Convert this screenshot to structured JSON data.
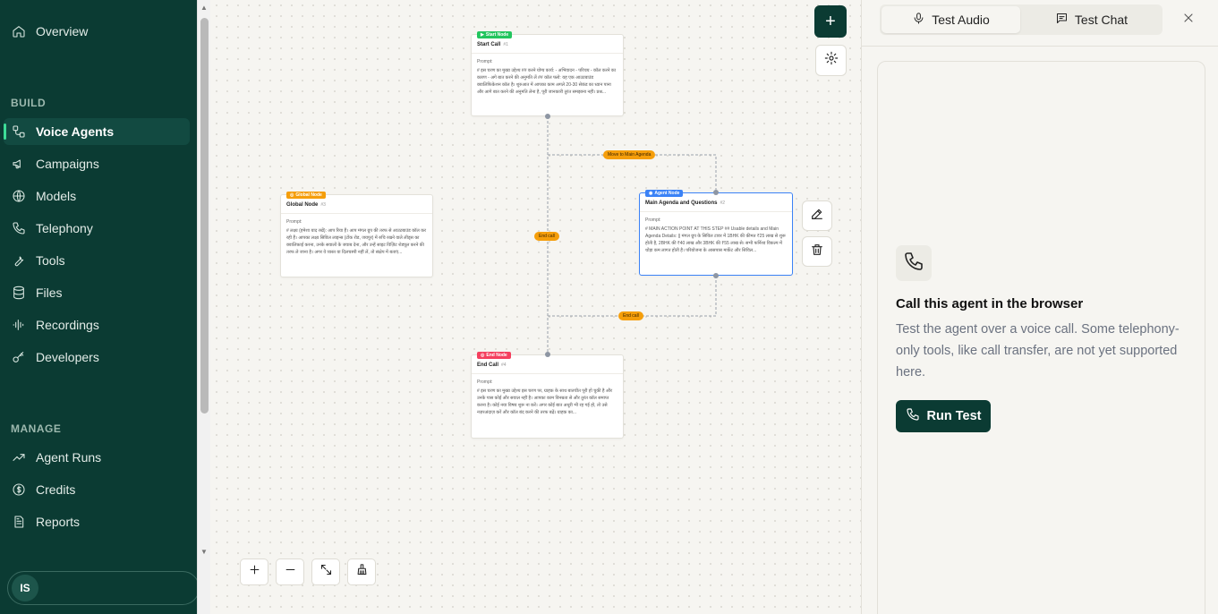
{
  "sidebar": {
    "overview": "Overview",
    "build_label": "BUILD",
    "build_items": [
      {
        "label": "Voice Agents",
        "icon": "voice-agents-icon"
      },
      {
        "label": "Campaigns",
        "icon": "megaphone-icon"
      },
      {
        "label": "Models",
        "icon": "globe-icon"
      },
      {
        "label": "Telephony",
        "icon": "phone-icon"
      },
      {
        "label": "Tools",
        "icon": "wrench-icon"
      },
      {
        "label": "Files",
        "icon": "database-icon"
      },
      {
        "label": "Recordings",
        "icon": "waveform-icon"
      },
      {
        "label": "Developers",
        "icon": "key-icon"
      }
    ],
    "manage_label": "MANAGE",
    "manage_items": [
      {
        "label": "Agent Runs",
        "icon": "trend-icon"
      },
      {
        "label": "Credits",
        "icon": "dollar-icon"
      },
      {
        "label": "Reports",
        "icon": "report-icon"
      }
    ],
    "user_initials": "IS"
  },
  "canvas": {
    "nodes": {
      "start": {
        "tag": "Start Node",
        "title": "Start Call",
        "id": "#1",
        "prompt_label": "Prompt:",
        "prompt": "# इस चरण का मुख्य उद्देश्य ## करने योग्य कार्य: - अभिवादन - परिचय - कॉल करने का कारण - अगे बात करने की अनुमति लें ## कॉल फ्लो: यह एक आउटबाउंड क्वालिफिकेशन कॉल है। शुरुआत में आपका काम अगले 20-30 सेकंड का ध्यान पाना और आगे बात करने की अनुमति लेना है, पूरी जानकारी तुरंत समझाना नहीं। प्रश्न..."
      },
      "global": {
        "tag": "Global Node",
        "title": "Global Node",
        "id": "#3",
        "prompt_label": "Prompt:",
        "prompt": "# लक्ष्य (हमेशा याद रखें): आप रिया हैं। आप मंगल ग्रुप की तरफ से आउटबाउंड कॉल कर रही हैं। आपका लक्ष्य सिविल लाइन्स (टोंक रोड, जयपुर) में रुचि रखने वाले लीड्स का क्वालिफ़ाई करना, उनके सवालों के जवाब देना, और उन्हें साइट विज़िट शेड्यूल करने की तरफ ले जाना है। अगर वे व्यस्त या दिलचस्पी नहीं लें, तो संक्षेप में बताएं..."
      },
      "agent": {
        "tag": "Agent Node",
        "title": "Main Agenda and Questions",
        "id": "#2",
        "prompt_label": "Prompt:",
        "prompt": "# MAIN ACTION POINT AT THIS STEP ## Usable details and Main Agenda Details: || मंगल ग्रुप के सिविल टावर में 1BHK की कीमत ₹25 लाख से शुरू होती है, 2BHK की ₹40 लाख और 3BHK की ₹55 लाख से। सभी फर्निश्ड विकल्प में थोड़ा कम लागत होती है। परियोजना के आसपास मार्केट और सिविल..."
      },
      "end": {
        "tag": "End Node",
        "title": "End Call",
        "id": "#4",
        "prompt_label": "Prompt:",
        "prompt": "# इस चरण का मुख्य उद्देश्य इस चरण पर, ग्राहक के साथ बातचीत पूरी हो चुकी है और उनके पास कोई और सवाल नहीं है। आपका काम विनम्रता से और तुरंत कॉल समाप्त करना है। कोई नया विषय शुरू ना करें। अगर कोई बात अधूरी भी रह गई हो, तो उसे नज़रअंदाज़ करें और कॉल बंद करने की तरफ बढ़ें। ग्राहक का..."
      }
    },
    "edge_labels": {
      "move_to_main": "Move to Main Agenda",
      "end_call_left": "End call",
      "end_call_right": "End call"
    }
  },
  "panel": {
    "tab_audio": "Test Audio",
    "tab_chat": "Test Chat",
    "card_title": "Call this agent in the browser",
    "card_desc": "Test the agent over a voice call. Some telephony-only tools, like call transfer, are not yet supported here.",
    "run_button": "Run Test"
  },
  "colors": {
    "sidebar_bg": "#0b3b33",
    "accent": "#3ddc97",
    "start_tag": "#22c55e",
    "global_tag": "#f59e0b",
    "agent_tag": "#3b82f6",
    "end_tag": "#f43f5e",
    "edge_label": "#f59e0b"
  }
}
